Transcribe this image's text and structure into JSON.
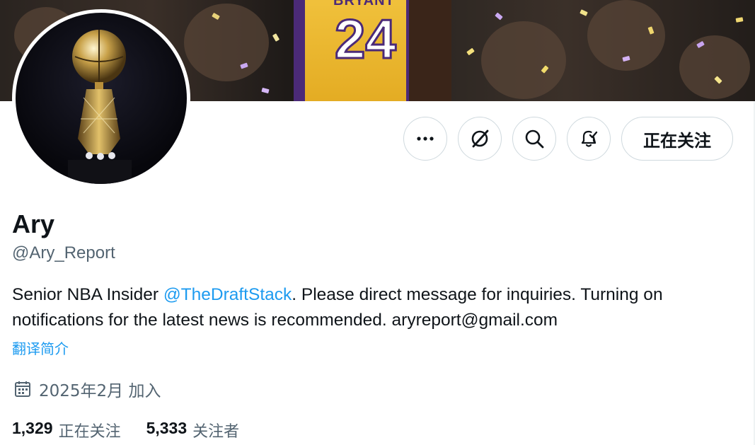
{
  "banner": {
    "jersey_name": "BRYANT",
    "jersey_number": "24"
  },
  "profile": {
    "display_name": "Ary",
    "handle": "@Ary_Report",
    "bio_prefix": "Senior NBA Insider ",
    "bio_mention": "@TheDraftStack",
    "bio_suffix": ". Please direct message for inquiries. Turning on notifications for the latest news is recommended. aryreport@gmail.com",
    "translate_label": "翻译简介",
    "joined": "2025年2月 加入"
  },
  "actions": {
    "more_icon": "more-horizontal-icon",
    "grok_icon": "grok-icon",
    "search_icon": "search-icon",
    "notify_icon": "bell-check-icon",
    "follow_label": "正在关注"
  },
  "stats": {
    "following_count": "1,329",
    "following_label": "正在关注",
    "followers_count": "5,333",
    "followers_label": "关注者"
  },
  "colors": {
    "accent": "#1d9bf0",
    "text": "#0f1419",
    "muted": "#536471",
    "border": "#cfd9de"
  }
}
